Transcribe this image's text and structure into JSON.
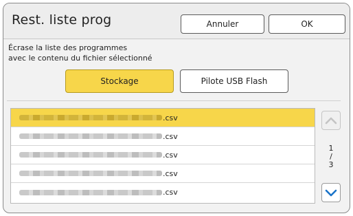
{
  "header": {
    "title": "Rest. liste prog",
    "cancel_label": "Annuler",
    "ok_label": "OK"
  },
  "description": {
    "line1": "Écrase la liste des programmes",
    "line2": "avec le contenu du fichier sélectionné"
  },
  "source": {
    "storage_label": "Stockage",
    "usb_label": "Pilote USB Flash",
    "selected": "Stockage"
  },
  "files": [
    {
      "name": ".csv",
      "selected": true
    },
    {
      "name": ".csv",
      "selected": false
    },
    {
      "name": ".csv",
      "selected": false
    },
    {
      "name": ".csv",
      "selected": false
    },
    {
      "name": ".csv",
      "selected": false
    }
  ],
  "pager": {
    "current": "1",
    "separator": "/",
    "total": "3"
  },
  "colors": {
    "accent": "#f7d64a",
    "scroll_arrow": "#1a73c8"
  },
  "icons": {
    "scroll_up": "chevron-up-icon",
    "scroll_down": "chevron-down-icon"
  }
}
